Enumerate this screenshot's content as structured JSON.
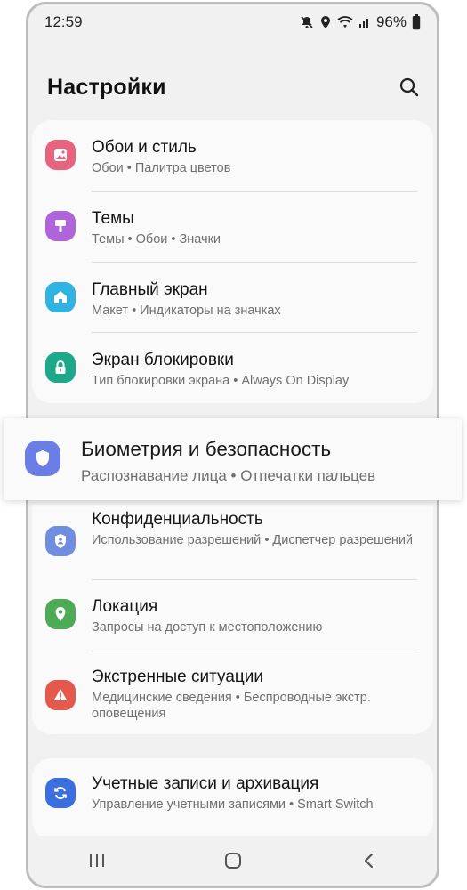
{
  "status_bar": {
    "time": "12:59",
    "battery": "96%",
    "icons": [
      "mute-icon",
      "location-icon",
      "wifi-icon",
      "signal-icon",
      "battery-icon"
    ]
  },
  "header": {
    "title": "Настройки",
    "search_icon": "search-icon"
  },
  "groups": [
    {
      "items": [
        {
          "title": "Обои и стиль",
          "subtitle": "Обои • Палитра цветов",
          "icon": "wallpaper-icon",
          "color": "#e8647e"
        },
        {
          "title": "Темы",
          "subtitle": "Темы • Обои • Значки",
          "icon": "theme-brush-icon",
          "color": "#b064d9"
        },
        {
          "title": "Главный экран",
          "subtitle": "Макет • Индикаторы на значках",
          "icon": "home-icon",
          "color": "#2fb3e0"
        },
        {
          "title": "Экран блокировки",
          "subtitle": "Тип блокировки экрана • Always On Display",
          "icon": "lock-icon",
          "color": "#1da989"
        }
      ]
    },
    {
      "items": [
        {
          "title": "Биометрия и безопасность",
          "subtitle": "Распознавание лица • Отпечатки пальцев",
          "icon": "shield-icon",
          "color": "#6a7ee6",
          "highlighted": true
        },
        {
          "title": "Конфиденциальность",
          "subtitle": "Использование разрешений • Диспетчер разрешений",
          "icon": "privacy-shield-icon",
          "color": "#6f8ee0"
        },
        {
          "title": "Локация",
          "subtitle": "Запросы на доступ к местоположению",
          "icon": "location-pin-icon",
          "color": "#4daa55"
        },
        {
          "title": "Экстренные ситуации",
          "subtitle": "Медицинские сведения • Беспроводные экстр. оповещения",
          "icon": "emergency-icon",
          "color": "#e5584c"
        }
      ]
    },
    {
      "items": [
        {
          "title": "Учетные записи и архивация",
          "subtitle": "Управление учетными записями • Smart Switch",
          "icon": "sync-icon",
          "color": "#3a6fe0"
        }
      ]
    }
  ],
  "nav_bar": {
    "icons": [
      "recents-icon",
      "home-button-icon",
      "back-icon"
    ]
  }
}
